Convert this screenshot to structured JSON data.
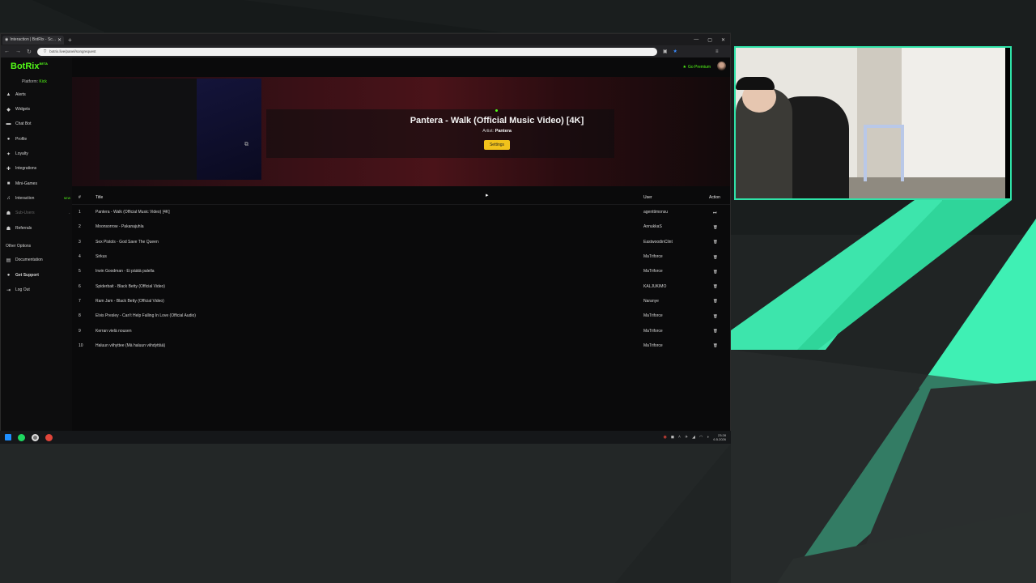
{
  "browser": {
    "tab_title": "Interaction | BotRix - Sc...",
    "url": "botrix.live/panel/songrequest",
    "window_controls": [
      "—",
      "▢",
      "✕"
    ]
  },
  "app": {
    "brand": "BotRix",
    "brand_tag": "BETA",
    "platform_label": "Platform:",
    "platform_value": "Kick",
    "premium_label": "Go Premium",
    "nav": [
      {
        "label": "Alerts",
        "icon": "alert-icon"
      },
      {
        "label": "Widgets",
        "icon": "widget-icon"
      },
      {
        "label": "Chat Bot",
        "icon": "chat-icon"
      },
      {
        "label": "Profile",
        "icon": "profile-icon"
      },
      {
        "label": "Loyalty",
        "icon": "loyalty-icon"
      },
      {
        "label": "Integrations",
        "icon": "integrations-icon"
      },
      {
        "label": "Mini-Games",
        "icon": "games-icon"
      },
      {
        "label": "Interaction",
        "icon": "music-icon",
        "badge": "NEW"
      },
      {
        "label": "Sub-Users",
        "icon": "users-icon"
      },
      {
        "label": "Referrals",
        "icon": "referrals-icon"
      }
    ],
    "other_heading": "Other Options",
    "other": [
      {
        "label": "Documentation",
        "icon": "doc-icon"
      },
      {
        "label": "Get Support",
        "icon": "support-icon"
      },
      {
        "label": "Log Out",
        "icon": "logout-icon"
      }
    ]
  },
  "now_playing": {
    "title": "Pantera - Walk (Official Music Video) [4K]",
    "artist_label": "Artist:",
    "artist": "Pantera",
    "settings_label": "Settings"
  },
  "queue": {
    "headers": {
      "num": "#",
      "title": "Title",
      "user": "User",
      "action": "Action"
    },
    "rows": [
      {
        "num": "1",
        "title": "Pantera - Walk (Official Music Video) [4K]",
        "user": "agenttimonsu",
        "action": "skip"
      },
      {
        "num": "2",
        "title": "Moonsorrow - Pakanajuhla",
        "user": "AnnukkaS",
        "action": "delete"
      },
      {
        "num": "3",
        "title": "Sex Pistols - God Save The Queen",
        "user": "EastwoodinClint",
        "action": "delete"
      },
      {
        "num": "4",
        "title": "Sirkus",
        "user": "MaTriforce",
        "action": "delete"
      },
      {
        "num": "5",
        "title": "Irwin Goodman - Ei päätä palella",
        "user": "MaTriforce",
        "action": "delete"
      },
      {
        "num": "6",
        "title": "Spiderbait - Black Betty (Official Video)",
        "user": "KALJUKIMO",
        "action": "delete"
      },
      {
        "num": "7",
        "title": "Ram Jam - Black Betty (Official Video)",
        "user": "Naranye",
        "action": "delete"
      },
      {
        "num": "8",
        "title": "Elvis Presley - Can't Help Falling In Love (Official Audio)",
        "user": "MaTriforce",
        "action": "delete"
      },
      {
        "num": "9",
        "title": "Kerran vielä nousen",
        "user": "MaTriforce",
        "action": "delete"
      },
      {
        "num": "10",
        "title": "Haluun viihyttee (Mä haluun viihdyttää)",
        "user": "MaTriforce",
        "action": "delete"
      }
    ]
  },
  "taskbar": {
    "time": "23:28",
    "date": "6.5.2026"
  },
  "colors": {
    "brand_green": "#53fc18",
    "settings_yellow": "#f1c21b",
    "webcam_border": "#2fe3a8",
    "accent_teal": "#3ff0b4"
  }
}
